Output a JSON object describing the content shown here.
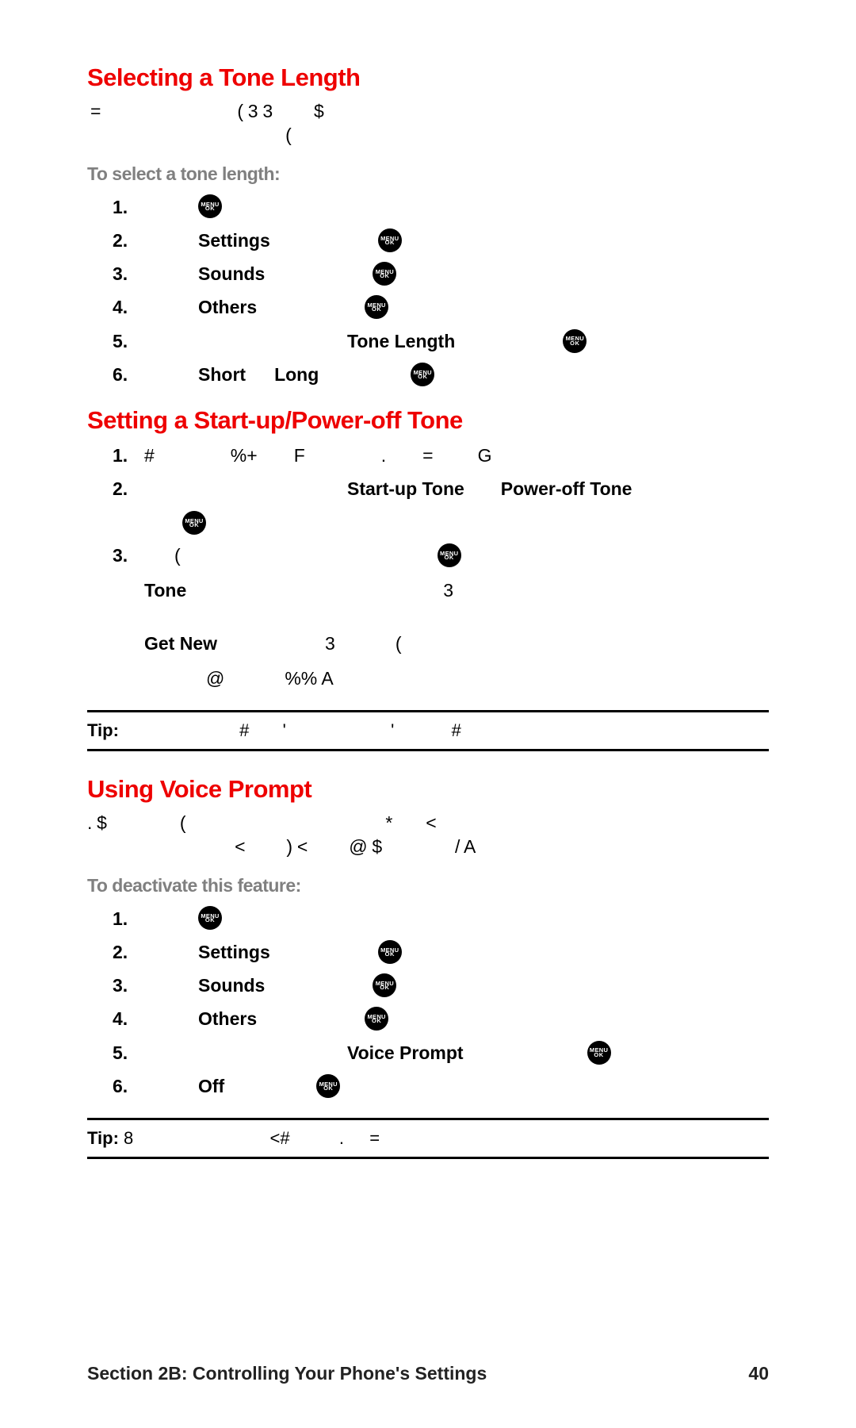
{
  "s1": {
    "title": "Selecting a Tone Length",
    "para_fragments": [
      "=",
      "( 3 3",
      "$",
      "("
    ],
    "subh": "To select a tone length:",
    "steps": [
      {
        "num": "1.",
        "item": "",
        "extra": ""
      },
      {
        "num": "2.",
        "item": "Settings",
        "extra": ""
      },
      {
        "num": "3.",
        "item": "Sounds",
        "extra": ""
      },
      {
        "num": "4.",
        "item": "Others",
        "extra": ""
      },
      {
        "num": "5.",
        "item": "",
        "extra": "Tone Length"
      },
      {
        "num": "6.",
        "item": "Short",
        "extra2": "Long"
      }
    ]
  },
  "s2": {
    "title": "Setting a Start-up/Power-off Tone",
    "steps": [
      {
        "num": "1.",
        "frags": [
          "#",
          "%+",
          "F",
          ".",
          "=",
          "G"
        ]
      },
      {
        "num": "2.",
        "b1": "Start-up Tone",
        "b2": "Power-off Tone"
      },
      {
        "num": "3.",
        "frags": [
          "("
        ],
        "sub1": {
          "b": "Tone",
          "t": "3"
        },
        "sub2": {
          "b": "Get New",
          "t1": "3",
          "t2": "("
        },
        "sub3": {
          "t1": "@",
          "t2": "%% A"
        }
      }
    ],
    "tip_label": "Tip:",
    "tip_frags": [
      "#",
      "'",
      "'",
      "#"
    ]
  },
  "s3": {
    "title": "Using Voice Prompt",
    "para_frags_l1": [
      ". $",
      "(",
      "*",
      "<"
    ],
    "para_frags_l2": [
      "<",
      ") <",
      "@ $",
      "/ A"
    ],
    "subh": "To deactivate this feature:",
    "steps": [
      {
        "num": "1.",
        "item": ""
      },
      {
        "num": "2.",
        "item": "Settings"
      },
      {
        "num": "3.",
        "item": "Sounds"
      },
      {
        "num": "4.",
        "item": "Others"
      },
      {
        "num": "5.",
        "item": "",
        "extra": "Voice Prompt"
      },
      {
        "num": "6.",
        "item": "Off"
      }
    ],
    "tip_label": "Tip:",
    "tip_pre": "8",
    "tip_frags": [
      "<#",
      ".",
      "="
    ]
  },
  "footer": {
    "section": "Section 2B: Controlling Your Phone's Settings",
    "page": "40"
  },
  "icon": {
    "l1": "MENU",
    "l2": "OK"
  }
}
